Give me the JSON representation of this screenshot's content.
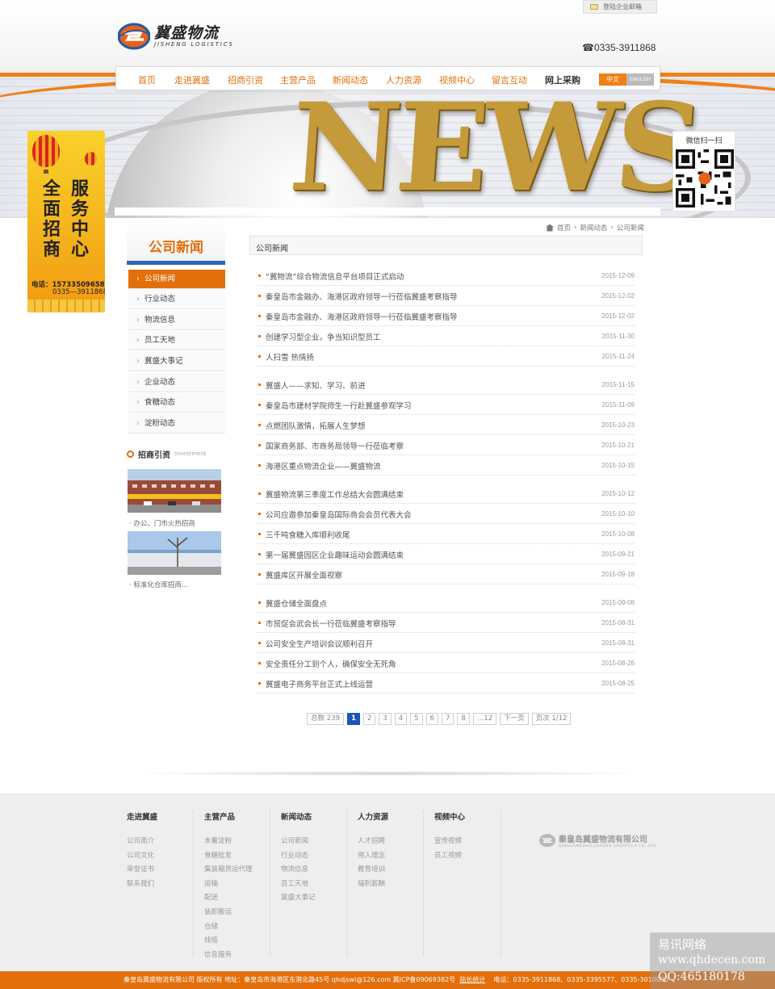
{
  "header": {
    "mail_link": "登陆企业邮箱",
    "logo_cn": "冀盛物流",
    "logo_en": "JISHENG LOGISTICS",
    "phone": "0335-3911868"
  },
  "nav": {
    "items": [
      "首页",
      "走进冀盛",
      "招商引资",
      "主营产品",
      "新闻动态",
      "人力资源",
      "视频中心",
      "留言互动",
      "网上采购"
    ],
    "lang_cn": "中文",
    "lang_en": "ENGLISH"
  },
  "banner": {
    "word": "NEWS"
  },
  "side_ad": {
    "col1": "全面招商",
    "col2": "服务中心",
    "phone1": "电话：15733509658",
    "phone2": "0335—3911868"
  },
  "qr": {
    "label": "微信扫一扫"
  },
  "sidebar": {
    "title": "公司新闻",
    "items": [
      "公司新闻",
      "行业动态",
      "物流信息",
      "员工天地",
      "冀盛大事记",
      "企业动态",
      "食糖动态",
      "淀粉动态"
    ],
    "invest_title": "招商引资",
    "invest_en": "Investment",
    "thumb_captions": [
      "· 办公、门市火热招商",
      "· 标准化仓库招商…"
    ]
  },
  "breadcrumb": [
    "首页",
    "新闻动态",
    "公司新闻"
  ],
  "list_title": "公司新闻",
  "news": [
    {
      "title": "“冀物流”综合物流信息平台项目正式启动",
      "date": "2015-12-09"
    },
    {
      "title": "秦皇岛市金融办、海港区政府领导一行莅临冀盛考察指导",
      "date": "2015-12-02"
    },
    {
      "title": "秦皇岛市金融办、海港区政府领导一行莅临冀盛考察指导",
      "date": "2015-12-02"
    },
    {
      "title": "创建学习型企业，争当知识型员工",
      "date": "2015-11-30"
    },
    {
      "title": "人扫雪  热情扬",
      "date": "2015-11-24"
    },
    {
      "title": "冀盛人——求知、学习、前进",
      "date": "2015-11-15"
    },
    {
      "title": "秦皇岛市建材学院师生一行赴冀盛参观学习",
      "date": "2015-11-09"
    },
    {
      "title": "点燃团队激情，拓展人生梦想",
      "date": "2015-10-23"
    },
    {
      "title": "国家商务部、市商务局领导一行莅临考察",
      "date": "2015-10-21"
    },
    {
      "title": "海港区重点物流企业——冀盛物流",
      "date": "2015-10-15"
    },
    {
      "title": "冀盛物流第三季度工作总结大会圆满结束",
      "date": "2015-10-12"
    },
    {
      "title": "公司应邀参加秦皇岛国际商会会员代表大会",
      "date": "2015-10-10"
    },
    {
      "title": "三千吨食糖入库顺利收尾",
      "date": "2015-10-08"
    },
    {
      "title": "第一届冀盛园区企业趣味运动会圆满结束",
      "date": "2015-09-21"
    },
    {
      "title": "冀盛库区开展全面视察",
      "date": "2015-09-18"
    },
    {
      "title": "冀盛仓储全面盘点",
      "date": "2015-09-08"
    },
    {
      "title": "市贸促会武会长一行莅临冀盛考察指导",
      "date": "2015-08-31"
    },
    {
      "title": "公司安全生产培训会议顺利召开",
      "date": "2015-08-31"
    },
    {
      "title": "安全责任分工到个人，确保安全无死角",
      "date": "2015-08-26"
    },
    {
      "title": "冀盛电子商务平台正式上线运营",
      "date": "2015-08-25"
    }
  ],
  "pager": {
    "total": "总数 239",
    "pages": [
      "1",
      "2",
      "3",
      "4",
      "5",
      "6",
      "7",
      "8"
    ],
    "current": "1",
    "ellipsis": "…12",
    "next": "下一页",
    "page_info": "页次 1/12"
  },
  "footer": {
    "columns": [
      {
        "title": "走进冀盛",
        "links": [
          "公司简介",
          "公司文化",
          "荣誉证书",
          "联系我们"
        ]
      },
      {
        "title": "主营产品",
        "links": [
          "木薯淀粉",
          "食糖批发",
          "集装箱货运代理",
          "运输",
          "配送",
          "装卸搬运",
          "仓储",
          "线缆",
          "信息服务"
        ]
      },
      {
        "title": "新闻动态",
        "links": [
          "公司新闻",
          "行业动态",
          "物流信息",
          "员工天地",
          "冀盛大事记"
        ]
      },
      {
        "title": "人力资源",
        "links": [
          "人才招聘",
          "用人理念",
          "教育培训",
          "福利薪酬"
        ]
      },
      {
        "title": "视频中心",
        "links": [
          "宣传视频",
          "员工视频"
        ]
      }
    ],
    "logo_cn": "秦皇岛冀盛物流有限公司",
    "logo_en": "QINHUANGDAO JISHENG LOGISTICS CO.,LTD",
    "bottom_text": "秦皇岛冀盛物流有限公司  版权所有  地址：秦皇岛市海港区东港北路45号  qhdjswl@126.com  冀ICP备09069382号",
    "bottom_link": "站长统计",
    "bottom_phones": "电话：0335-3911868、0335-3395577、0335-3010090"
  },
  "watermark": [
    "易讯网络",
    "www.qhdecen.com",
    "QQ:465180178"
  ],
  "colors": {
    "accent": "#e26f0c",
    "nav_accent": "#f07f16",
    "blue": "#2e68b0"
  }
}
